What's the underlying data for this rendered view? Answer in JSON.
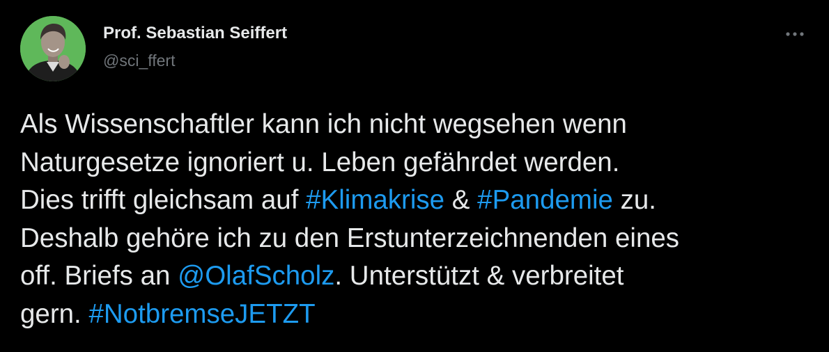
{
  "author": {
    "name": "Prof. Sebastian Seiffert",
    "handle": "@sci_ffert"
  },
  "colors": {
    "background": "#000000",
    "text": "#e7e9ea",
    "secondary": "#71767b",
    "link": "#1d9bf0",
    "avatar_background": "#5fb85a"
  },
  "icons": {
    "more": "more-horizontal-icon"
  },
  "tweet": {
    "line1": {
      "t1": "Als Wissenschaftler kann ich nicht wegsehen wenn"
    },
    "line2": {
      "t1": "Naturgesetze ignoriert u. Leben gefährdet werden."
    },
    "line3": {
      "t1": "Dies trifft gleichsam auf ",
      "hashtag1": "#Klimakrise",
      "t2": " & ",
      "hashtag2": "#Pandemie",
      "t3": " zu."
    },
    "line4": {
      "t1": "Deshalb gehöre ich zu den Erstunterzeichnenden eines"
    },
    "line5": {
      "t1": "off. Briefs an ",
      "mention": "@OlafScholz",
      "t2": ". Unterstützt & verbreitet"
    },
    "line6": {
      "t1": "gern. ",
      "hashtag3": "#NotbremseJETZT"
    }
  }
}
